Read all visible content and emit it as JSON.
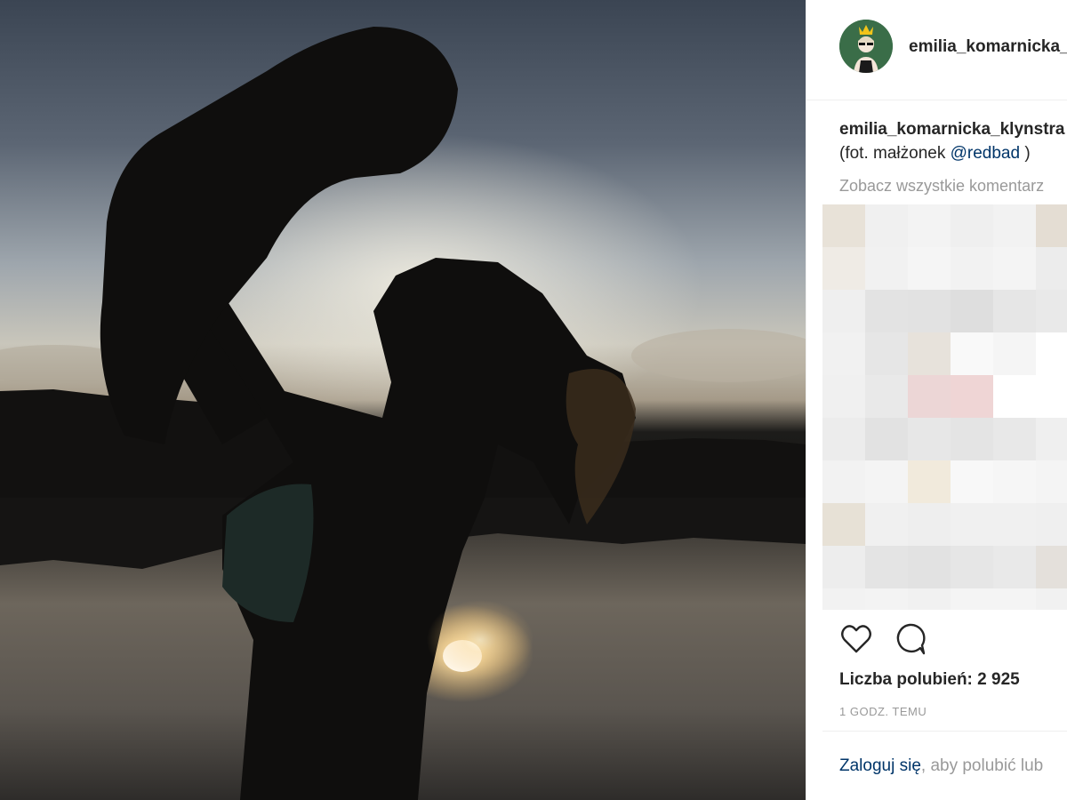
{
  "post": {
    "photo": {
      "description_icon": "photo-icon",
      "sun_color": "#fff6d8",
      "silhouette_color": "#0f0e0d"
    }
  },
  "header": {
    "username": "emilia_komarnicka_",
    "avatar_icon": "profile-avatar-icon"
  },
  "caption": {
    "username": "emilia_komarnicka_klynstra",
    "text_prefix": "(fot. małżonek ",
    "mention": "@redbad",
    "text_suffix": " )"
  },
  "comments": {
    "view_all_label": "Zobacz wszystkie komentarz"
  },
  "actions": {
    "like_icon": "heart-icon",
    "comment_icon": "comment-icon"
  },
  "likes": {
    "label": "Liczba polubień: 2 925"
  },
  "timestamp": "1 GODZ. TEMU",
  "login_prompt": {
    "link_label": "Zaloguj się",
    "rest": ", aby polubić lub"
  },
  "colors": {
    "link": "#003569",
    "muted": "#999999",
    "text": "#262626"
  }
}
